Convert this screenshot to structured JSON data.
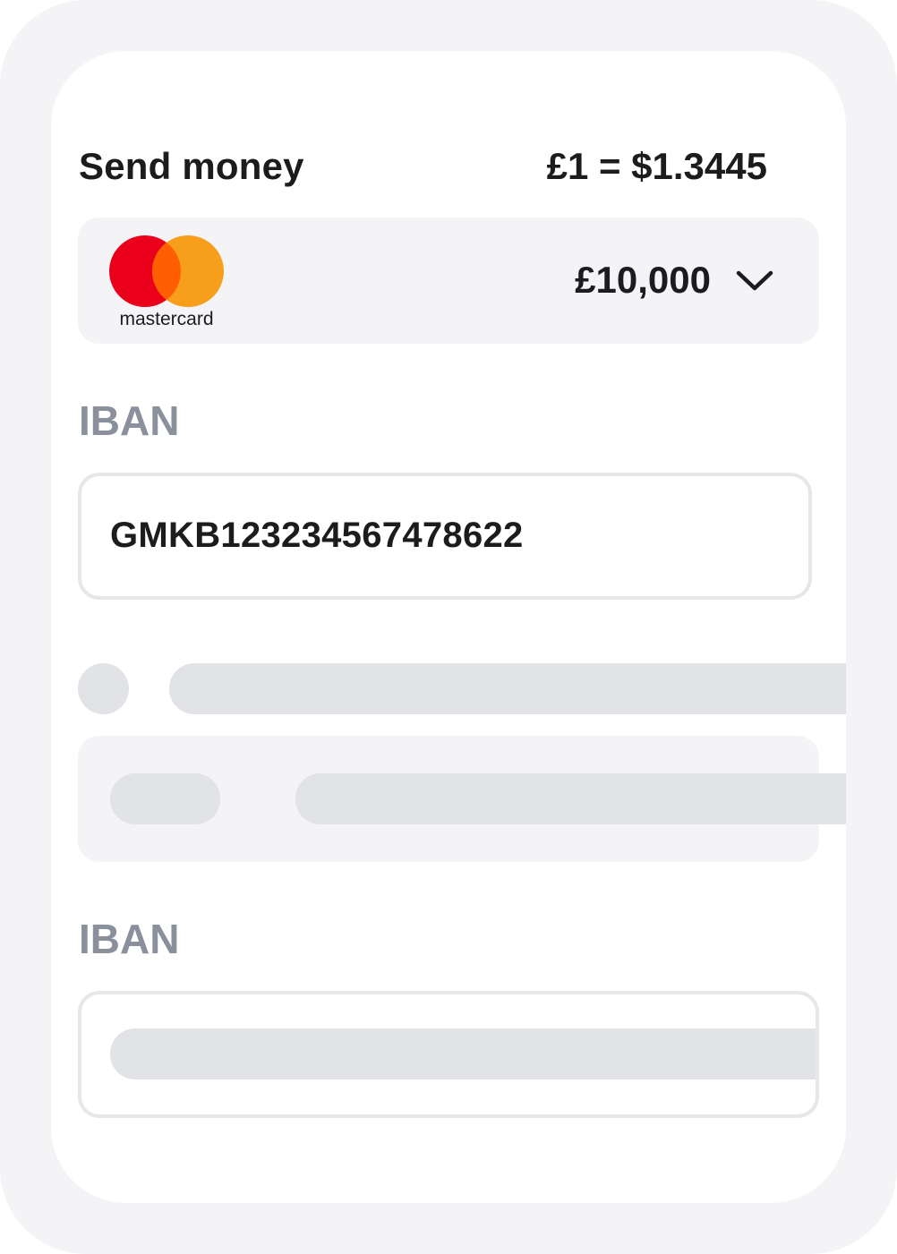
{
  "header": {
    "title": "Send money",
    "rate": "£1 = $1.3445"
  },
  "card_selector": {
    "brand": "mastercard",
    "amount": "£10,000",
    "icon": "chevron-down-icon"
  },
  "iban_section_1": {
    "label": "IBAN",
    "value": "GMKB123234567478622"
  },
  "iban_section_2": {
    "label": "IBAN",
    "value": ""
  },
  "colors": {
    "mastercard_red": "#eb001b",
    "mastercard_orange": "#f79e1b",
    "mastercard_overlap": "#ff5f00",
    "label_gray": "#8a909c",
    "skeleton": "#e2e3e7",
    "panel_bg": "#f4f4f6"
  }
}
